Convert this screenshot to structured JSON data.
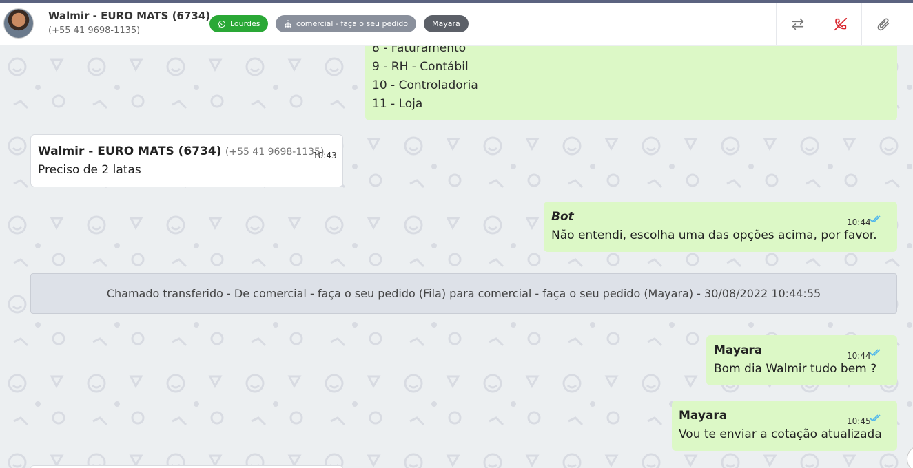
{
  "header": {
    "contact_name": "Walmir - EURO MATS (6734)",
    "contact_phone": "(+55 41 9698-1135)",
    "tags": {
      "channel": "Lourdes",
      "queue": "comercial - faça o seu pedido",
      "agent": "Mayara"
    },
    "icons": {
      "transfer": "transfer-arrows-icon",
      "hangup": "phone-off-icon",
      "attach": "paperclip-icon"
    }
  },
  "colors": {
    "accent_top": "#5b6380",
    "tag_green": "#2aa836",
    "tag_gray": "#8a909c",
    "tag_dark": "#5c6068",
    "outgoing_bubble": "#dcf8c6",
    "incoming_bubble": "#ffffff",
    "system_bubble": "#dde1e8",
    "hangup_red": "#d9262e",
    "read_ticks": "#4fb6ec"
  },
  "messages": {
    "menu_lines": [
      "8 - Faturamento",
      "9 - RH - Contábil",
      "10 - Controladoria",
      "11 - Loja"
    ],
    "incoming_1": {
      "sender": "Walmir - EURO MATS (6734)",
      "phone": "(+55 41 9698-1135)",
      "time": "10:43",
      "text": "Preciso de 2 latas"
    },
    "bot_1": {
      "sender": "Bot",
      "time": "10:44",
      "text": "Não entendi, escolha uma das opções acima, por favor."
    },
    "system_1": {
      "text": "Chamado transferido - De comercial - faça o seu pedido (Fila) para comercial - faça o seu pedido (Mayara) - 30/08/2022 10:44:55"
    },
    "agent_1": {
      "sender": "Mayara",
      "time": "10:44",
      "text": "Bom dia Walmir tudo bem ?"
    },
    "agent_2": {
      "sender": "Mayara",
      "time": "10:45",
      "text": "Vou te enviar a cotação atualizada"
    }
  }
}
